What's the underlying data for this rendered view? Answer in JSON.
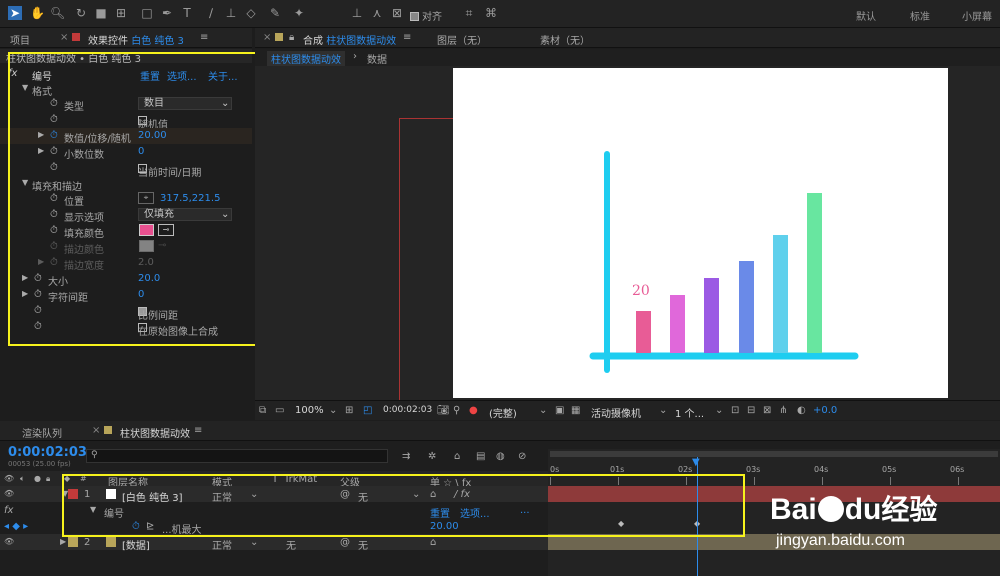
{
  "toolbar": {
    "align_label": "对齐",
    "workspaces": [
      "默认",
      "标准",
      "小屏幕"
    ]
  },
  "left_panel": {
    "tab_project": "项目",
    "tab_effects": "效果控件",
    "layer_name": "白色 纯色 3",
    "breadcrumb": "柱状图数据动效 • 白色 纯色 3",
    "effect": {
      "name": "编号",
      "reset": "重置",
      "options": "选项...",
      "about": "关于..."
    },
    "format_group": "格式",
    "type_label": "类型",
    "type_value": "数目",
    "random_label": "随机值",
    "value_label": "数值/位移/随机",
    "value_value": "20.00",
    "decimals_label": "小数位数",
    "decimals_value": "0",
    "datetime_label": "当前时间/日期",
    "fill_group": "填充和描边",
    "position_label": "位置",
    "position_value": "317.5,221.5",
    "display_label": "显示选项",
    "display_value": "仅填充",
    "fill_color_label": "填充颜色",
    "fill_color": "#e8508f",
    "stroke_color_label": "描边颜色",
    "stroke_width_label": "描边宽度",
    "stroke_width_value": "2.0",
    "size_label": "大小",
    "size_value": "20.0",
    "tracking_label": "字符间距",
    "tracking_value": "0",
    "proportional_label": "比例间距",
    "composite_label": "在原始图像上合成"
  },
  "comp_panel": {
    "tab_comp_prefix": "合成",
    "tab_comp_name": "柱状图数据动效",
    "layer_tab": "图层（无）",
    "footage_tab": "素材（无）",
    "sub_tab_active": "柱状图数据动效",
    "sub_tab_data": "数据",
    "label_text": "20",
    "bars": [
      {
        "color": "#e85c96"
      },
      {
        "color": "#e068da"
      },
      {
        "color": "#9b5ae4"
      },
      {
        "color": "#6a8ae8"
      },
      {
        "color": "#5fd0ec"
      },
      {
        "color": "#68e6a0"
      }
    ],
    "axis_color": "#1ecdf0",
    "bottom_bar": {
      "zoom": "100%",
      "timecode": "0:00:02:03",
      "quality": "(完整)",
      "camera": "活动摄像机",
      "views": "1 个...",
      "exposure": "+0.0"
    }
  },
  "timeline": {
    "tab_render": "渲染队列",
    "tab_comp": "柱状图数据动效",
    "timecode": "0:00:02:03",
    "fps_info": "00053 (25.00 fps)",
    "ruler": [
      "0s",
      "01s",
      "02s",
      "03s",
      "04s",
      "05s",
      "06s"
    ],
    "col_source": "图层名称",
    "col_mode": "模式",
    "col_t": "T",
    "col_trkmat": "TrkMat",
    "col_parent": "父级",
    "col_switches": "单 ☆ \\ fx",
    "layers": [
      {
        "num": "1",
        "name": "[白色 纯色 3]",
        "mode": "正常",
        "parent": "无",
        "color": "#c23a3a"
      },
      {
        "num": "2",
        "name": "[数据]",
        "mode": "正常",
        "trkmat": "无",
        "parent": "无",
        "color": "#b8a55a"
      }
    ],
    "effect_row": {
      "name": "编号",
      "reset": "重置",
      "options": "选项..."
    },
    "prop_row": {
      "name": "...机最大",
      "value": "20.00"
    }
  },
  "watermark": {
    "brand_a": "Bai",
    "brand_b": "du",
    "brand_c": "经验",
    "url": "jingyan.baidu.com"
  }
}
